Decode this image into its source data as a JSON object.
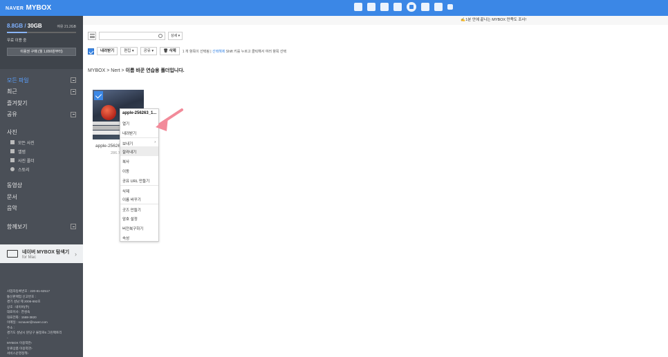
{
  "brand": {
    "naver": "NAVER",
    "mybox": "MYBOX"
  },
  "topbar": {
    "icons": [
      "mail-icon",
      "calendar-icon",
      "list-icon",
      "contacts-icon",
      "mybox-icon",
      "office-icon",
      "note-icon",
      "more-icon"
    ]
  },
  "sidebar": {
    "storage": {
      "used": "8.8GB",
      "total": "30GB",
      "remain": "여유 21.2GB",
      "free_label": "무료 이용 중",
      "buy_label": "이용권 구매 (월 1,650원부터)",
      "usage_fraction": 0.29
    },
    "nav": [
      {
        "label": "모든 파일",
        "active": true
      },
      {
        "label": "최근"
      },
      {
        "label": "즐겨찾기"
      },
      {
        "label": "공유"
      }
    ],
    "photos": {
      "title": "사진",
      "items": [
        "모든 사진",
        "앨범",
        "사진 폴더",
        "스토리"
      ]
    },
    "media": [
      "동영상",
      "문서",
      "음악"
    ],
    "together": "함께보기",
    "explorer": {
      "title": "네이버 MYBOX 탐색기",
      "sub": "for Mac"
    },
    "footer": [
      "사업자등록번호 : 220-81-62517",
      "통신판매업 신고번호 :",
      "경기 성남 제 2006-692호",
      "상호 : 네이버(주)",
      "대표이사 : 한성숙",
      "대표전화 : 1588-3820",
      "이메일 : ncnaver@naver.com",
      "주소 :",
      "경기도 성남시 분당구 불정로6 그린팩토리",
      "-",
      "MYBOX 이용약관›",
      "유료상품 이용약관›",
      "서비스운영정책›"
    ]
  },
  "main": {
    "notice": "1분 안에 끝나는 MYBOX 만족도 조사!",
    "search": {
      "placeholder": ""
    },
    "detail_label": "상세 ▾",
    "toolbar": {
      "download": "내려받기",
      "edit": "편집 ▾",
      "share": "공유 ▾",
      "delete": "삭제",
      "selection_info": "1 개 항목이 선택됨 |",
      "deselect": "선택해제",
      "hint": "Shift 키를 누르고 클릭해서 여러 항목 선택"
    },
    "breadcrumb": {
      "root": "MYBOX",
      "sep1": ">",
      "mid": "Nert",
      "sep2": ">",
      "current": "이름 바꾼 연습용 폴더입니다."
    },
    "file": {
      "name": "apple-25626",
      "size": "286.7"
    },
    "context_menu": {
      "title": "apple-256263_1...",
      "items": [
        "열기",
        "내려받기",
        "보내기",
        "잘라내기",
        "복사",
        "이동",
        "공유 URL 만들기",
        "삭제",
        "이름 바꾸기",
        "굿즈 만들기",
        "암호 설정",
        "버전복구하기",
        "속성"
      ]
    }
  },
  "colors": {
    "accent": "#3b87e6",
    "sidebar": "#4a4f57",
    "arrow": "#f28b9a"
  }
}
